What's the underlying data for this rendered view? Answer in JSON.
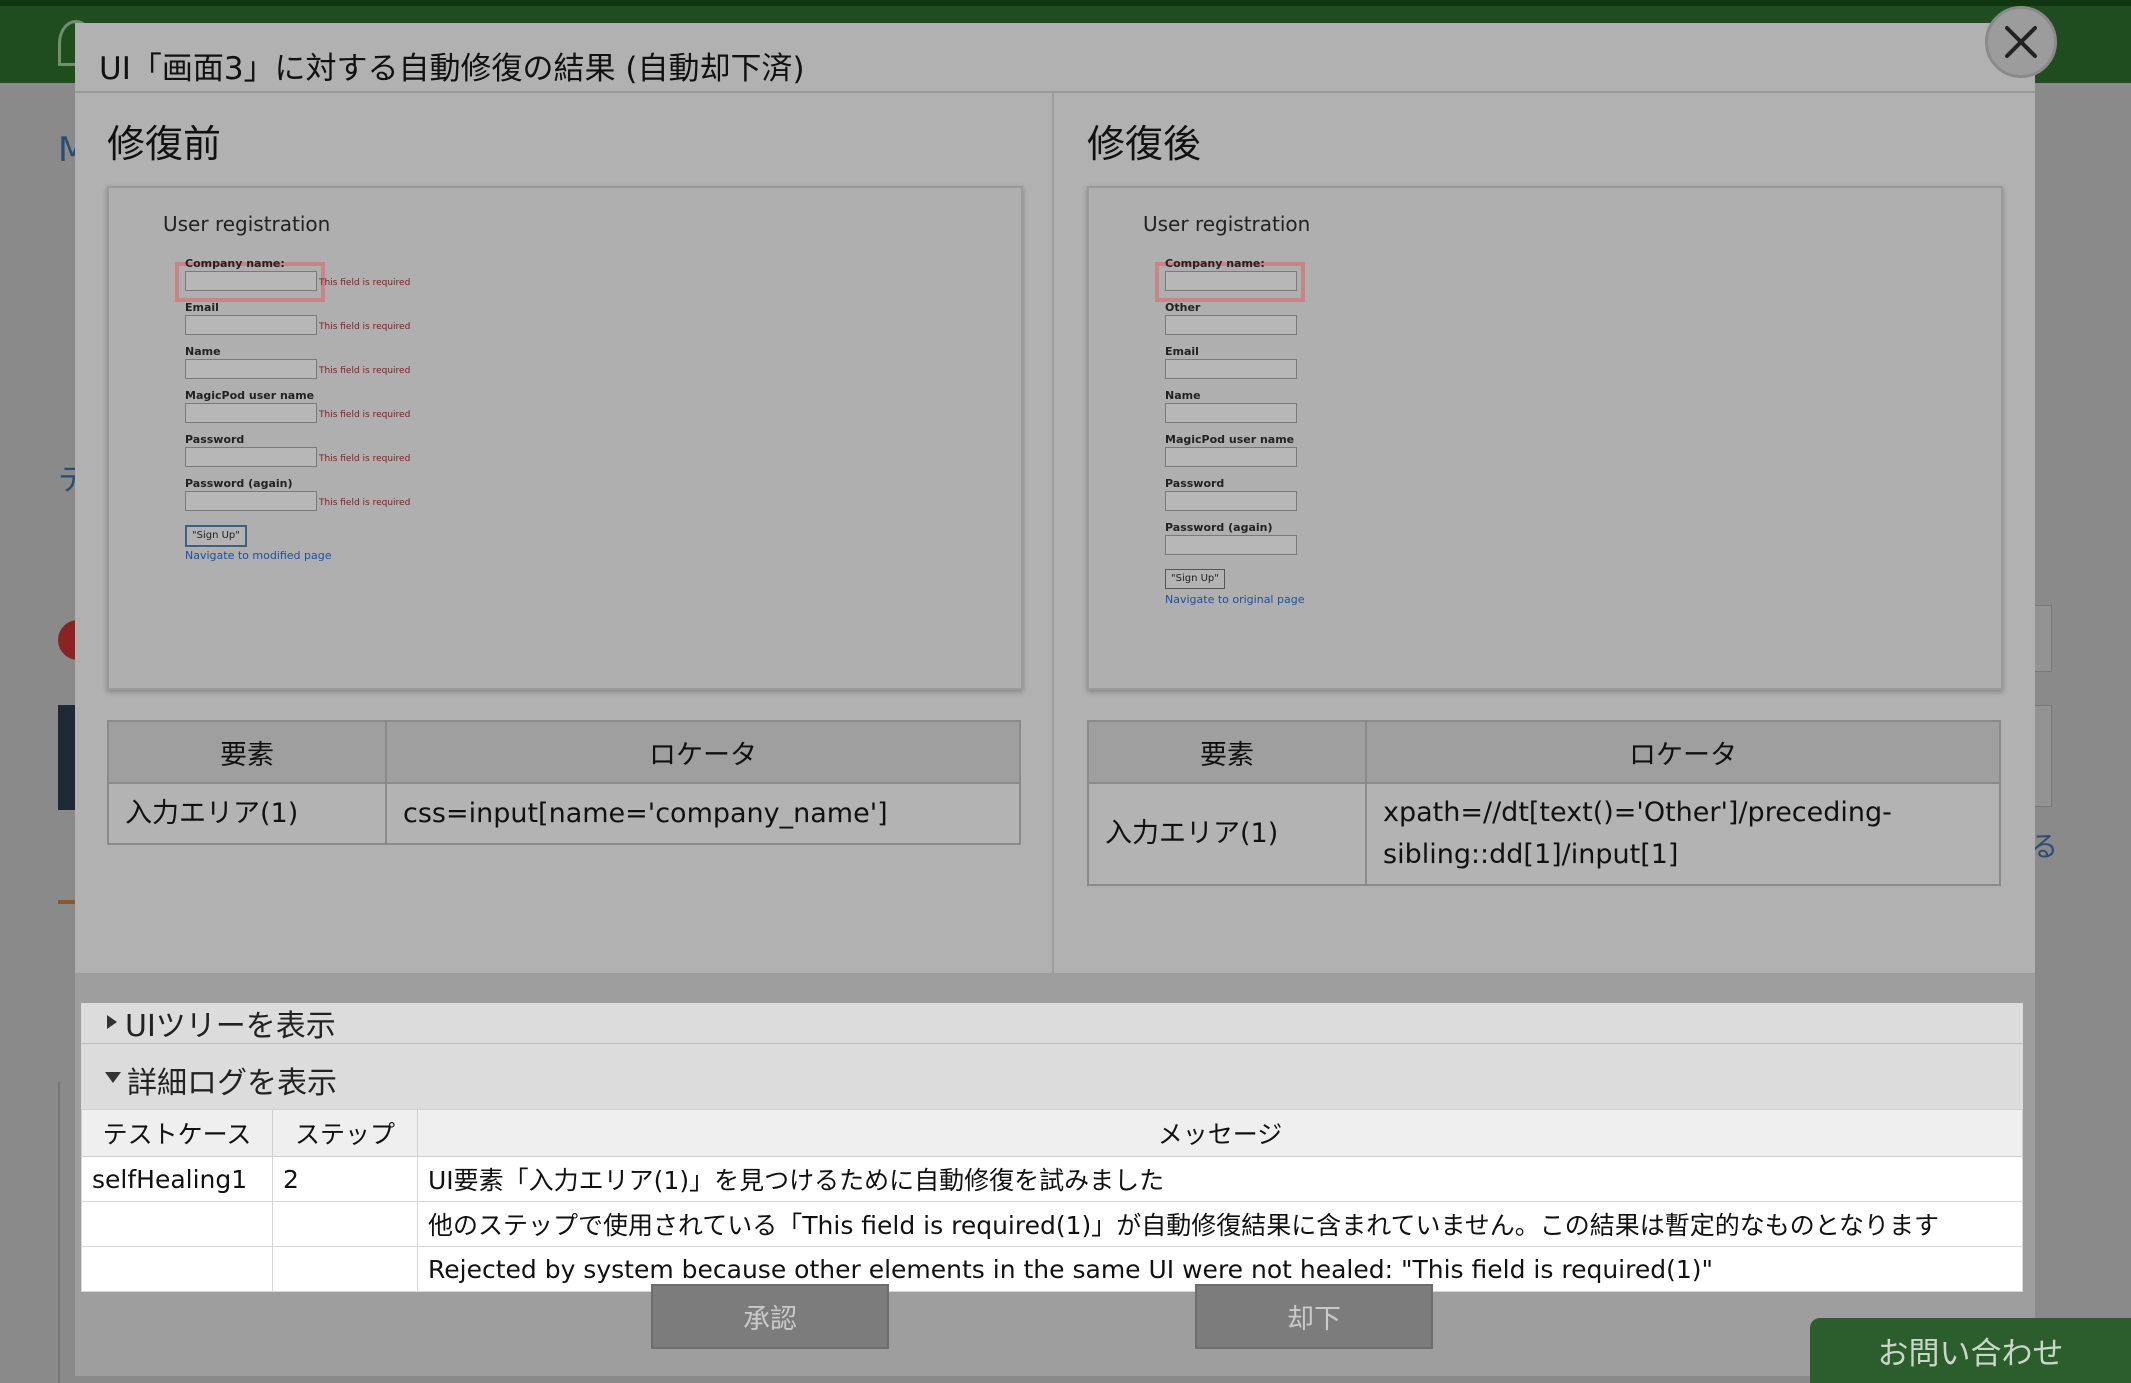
{
  "modal": {
    "title": "UI「画面3」に対する自動修復の結果 (自動却下済)",
    "close_label": "×"
  },
  "before": {
    "heading": "修復前",
    "screenshot": {
      "title": "User registration",
      "labels": [
        "Company name:",
        "Email",
        "Name",
        "MagicPod user name",
        "Password",
        "Password (again)"
      ],
      "error_text": "This field is required",
      "button": "\"Sign Up\"",
      "link": "Navigate to modified page"
    },
    "table": {
      "col_element": "要素",
      "col_locator": "ロケータ",
      "element": "入力エリア(1)",
      "locator": "css=input[name='company_name']"
    }
  },
  "after": {
    "heading": "修復後",
    "screenshot": {
      "title": "User registration",
      "labels": [
        "Company name:",
        "Other",
        "Email",
        "Name",
        "MagicPod user name",
        "Password",
        "Password (again)"
      ],
      "button": "\"Sign Up\"",
      "link": "Navigate to original page"
    },
    "table": {
      "col_element": "要素",
      "col_locator": "ロケータ",
      "element": "入力エリア(1)",
      "locator_line1": "xpath=//dt[text()='Other']/preceding-",
      "locator_line2": "sibling::dd[1]/input[1]"
    }
  },
  "ui_tree": {
    "label": "UIツリーを表示"
  },
  "log": {
    "label": "詳細ログを表示",
    "headers": [
      "テストケース",
      "ステップ",
      "メッセージ"
    ],
    "rows": [
      [
        "selfHealing1",
        "2",
        "UI要素「入力エリア(1)」を見つけるために自動修復を試みました"
      ],
      [
        "",
        "",
        "他のステップで使用されている「This field is required(1)」が自動修復結果に含まれていません。この結果は暫定的なものとなります"
      ],
      [
        "",
        "",
        "Rejected by system because other elements in the same UI were not healed: \"This field is required(1)\""
      ]
    ]
  },
  "buttons": {
    "approve": "承認",
    "reject": "却下"
  },
  "contact": {
    "label": "お問い合わせ"
  },
  "background": {
    "frag1": "M",
    "frag2": "テ",
    "frag3": "る"
  }
}
